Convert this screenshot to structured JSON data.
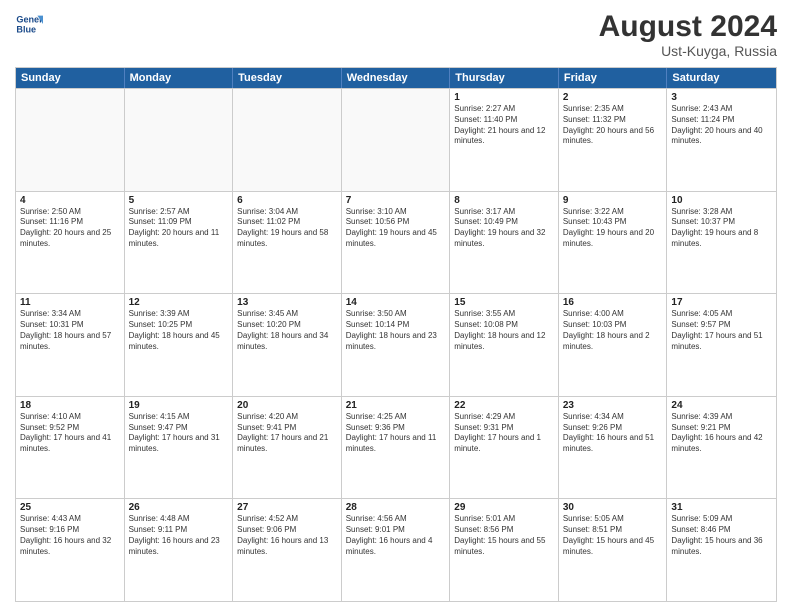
{
  "logo": {
    "line1": "General",
    "line2": "Blue"
  },
  "header": {
    "month_year": "August 2024",
    "location": "Ust-Kuyga, Russia"
  },
  "weekdays": [
    "Sunday",
    "Monday",
    "Tuesday",
    "Wednesday",
    "Thursday",
    "Friday",
    "Saturday"
  ],
  "rows": [
    [
      {
        "day": "",
        "empty": true
      },
      {
        "day": "",
        "empty": true
      },
      {
        "day": "",
        "empty": true
      },
      {
        "day": "",
        "empty": true
      },
      {
        "day": "1",
        "sunrise": "2:27 AM",
        "sunset": "11:40 PM",
        "daylight": "21 hours and 12 minutes."
      },
      {
        "day": "2",
        "sunrise": "2:35 AM",
        "sunset": "11:32 PM",
        "daylight": "20 hours and 56 minutes."
      },
      {
        "day": "3",
        "sunrise": "2:43 AM",
        "sunset": "11:24 PM",
        "daylight": "20 hours and 40 minutes."
      }
    ],
    [
      {
        "day": "4",
        "sunrise": "2:50 AM",
        "sunset": "11:16 PM",
        "daylight": "20 hours and 25 minutes."
      },
      {
        "day": "5",
        "sunrise": "2:57 AM",
        "sunset": "11:09 PM",
        "daylight": "20 hours and 11 minutes."
      },
      {
        "day": "6",
        "sunrise": "3:04 AM",
        "sunset": "11:02 PM",
        "daylight": "19 hours and 58 minutes."
      },
      {
        "day": "7",
        "sunrise": "3:10 AM",
        "sunset": "10:56 PM",
        "daylight": "19 hours and 45 minutes."
      },
      {
        "day": "8",
        "sunrise": "3:17 AM",
        "sunset": "10:49 PM",
        "daylight": "19 hours and 32 minutes."
      },
      {
        "day": "9",
        "sunrise": "3:22 AM",
        "sunset": "10:43 PM",
        "daylight": "19 hours and 20 minutes."
      },
      {
        "day": "10",
        "sunrise": "3:28 AM",
        "sunset": "10:37 PM",
        "daylight": "19 hours and 8 minutes."
      }
    ],
    [
      {
        "day": "11",
        "sunrise": "3:34 AM",
        "sunset": "10:31 PM",
        "daylight": "18 hours and 57 minutes."
      },
      {
        "day": "12",
        "sunrise": "3:39 AM",
        "sunset": "10:25 PM",
        "daylight": "18 hours and 45 minutes."
      },
      {
        "day": "13",
        "sunrise": "3:45 AM",
        "sunset": "10:20 PM",
        "daylight": "18 hours and 34 minutes."
      },
      {
        "day": "14",
        "sunrise": "3:50 AM",
        "sunset": "10:14 PM",
        "daylight": "18 hours and 23 minutes."
      },
      {
        "day": "15",
        "sunrise": "3:55 AM",
        "sunset": "10:08 PM",
        "daylight": "18 hours and 12 minutes."
      },
      {
        "day": "16",
        "sunrise": "4:00 AM",
        "sunset": "10:03 PM",
        "daylight": "18 hours and 2 minutes."
      },
      {
        "day": "17",
        "sunrise": "4:05 AM",
        "sunset": "9:57 PM",
        "daylight": "17 hours and 51 minutes."
      }
    ],
    [
      {
        "day": "18",
        "sunrise": "4:10 AM",
        "sunset": "9:52 PM",
        "daylight": "17 hours and 41 minutes."
      },
      {
        "day": "19",
        "sunrise": "4:15 AM",
        "sunset": "9:47 PM",
        "daylight": "17 hours and 31 minutes."
      },
      {
        "day": "20",
        "sunrise": "4:20 AM",
        "sunset": "9:41 PM",
        "daylight": "17 hours and 21 minutes."
      },
      {
        "day": "21",
        "sunrise": "4:25 AM",
        "sunset": "9:36 PM",
        "daylight": "17 hours and 11 minutes."
      },
      {
        "day": "22",
        "sunrise": "4:29 AM",
        "sunset": "9:31 PM",
        "daylight": "17 hours and 1 minute."
      },
      {
        "day": "23",
        "sunrise": "4:34 AM",
        "sunset": "9:26 PM",
        "daylight": "16 hours and 51 minutes."
      },
      {
        "day": "24",
        "sunrise": "4:39 AM",
        "sunset": "9:21 PM",
        "daylight": "16 hours and 42 minutes."
      }
    ],
    [
      {
        "day": "25",
        "sunrise": "4:43 AM",
        "sunset": "9:16 PM",
        "daylight": "16 hours and 32 minutes."
      },
      {
        "day": "26",
        "sunrise": "4:48 AM",
        "sunset": "9:11 PM",
        "daylight": "16 hours and 23 minutes."
      },
      {
        "day": "27",
        "sunrise": "4:52 AM",
        "sunset": "9:06 PM",
        "daylight": "16 hours and 13 minutes."
      },
      {
        "day": "28",
        "sunrise": "4:56 AM",
        "sunset": "9:01 PM",
        "daylight": "16 hours and 4 minutes."
      },
      {
        "day": "29",
        "sunrise": "5:01 AM",
        "sunset": "8:56 PM",
        "daylight": "15 hours and 55 minutes."
      },
      {
        "day": "30",
        "sunrise": "5:05 AM",
        "sunset": "8:51 PM",
        "daylight": "15 hours and 45 minutes."
      },
      {
        "day": "31",
        "sunrise": "5:09 AM",
        "sunset": "8:46 PM",
        "daylight": "15 hours and 36 minutes."
      }
    ]
  ]
}
